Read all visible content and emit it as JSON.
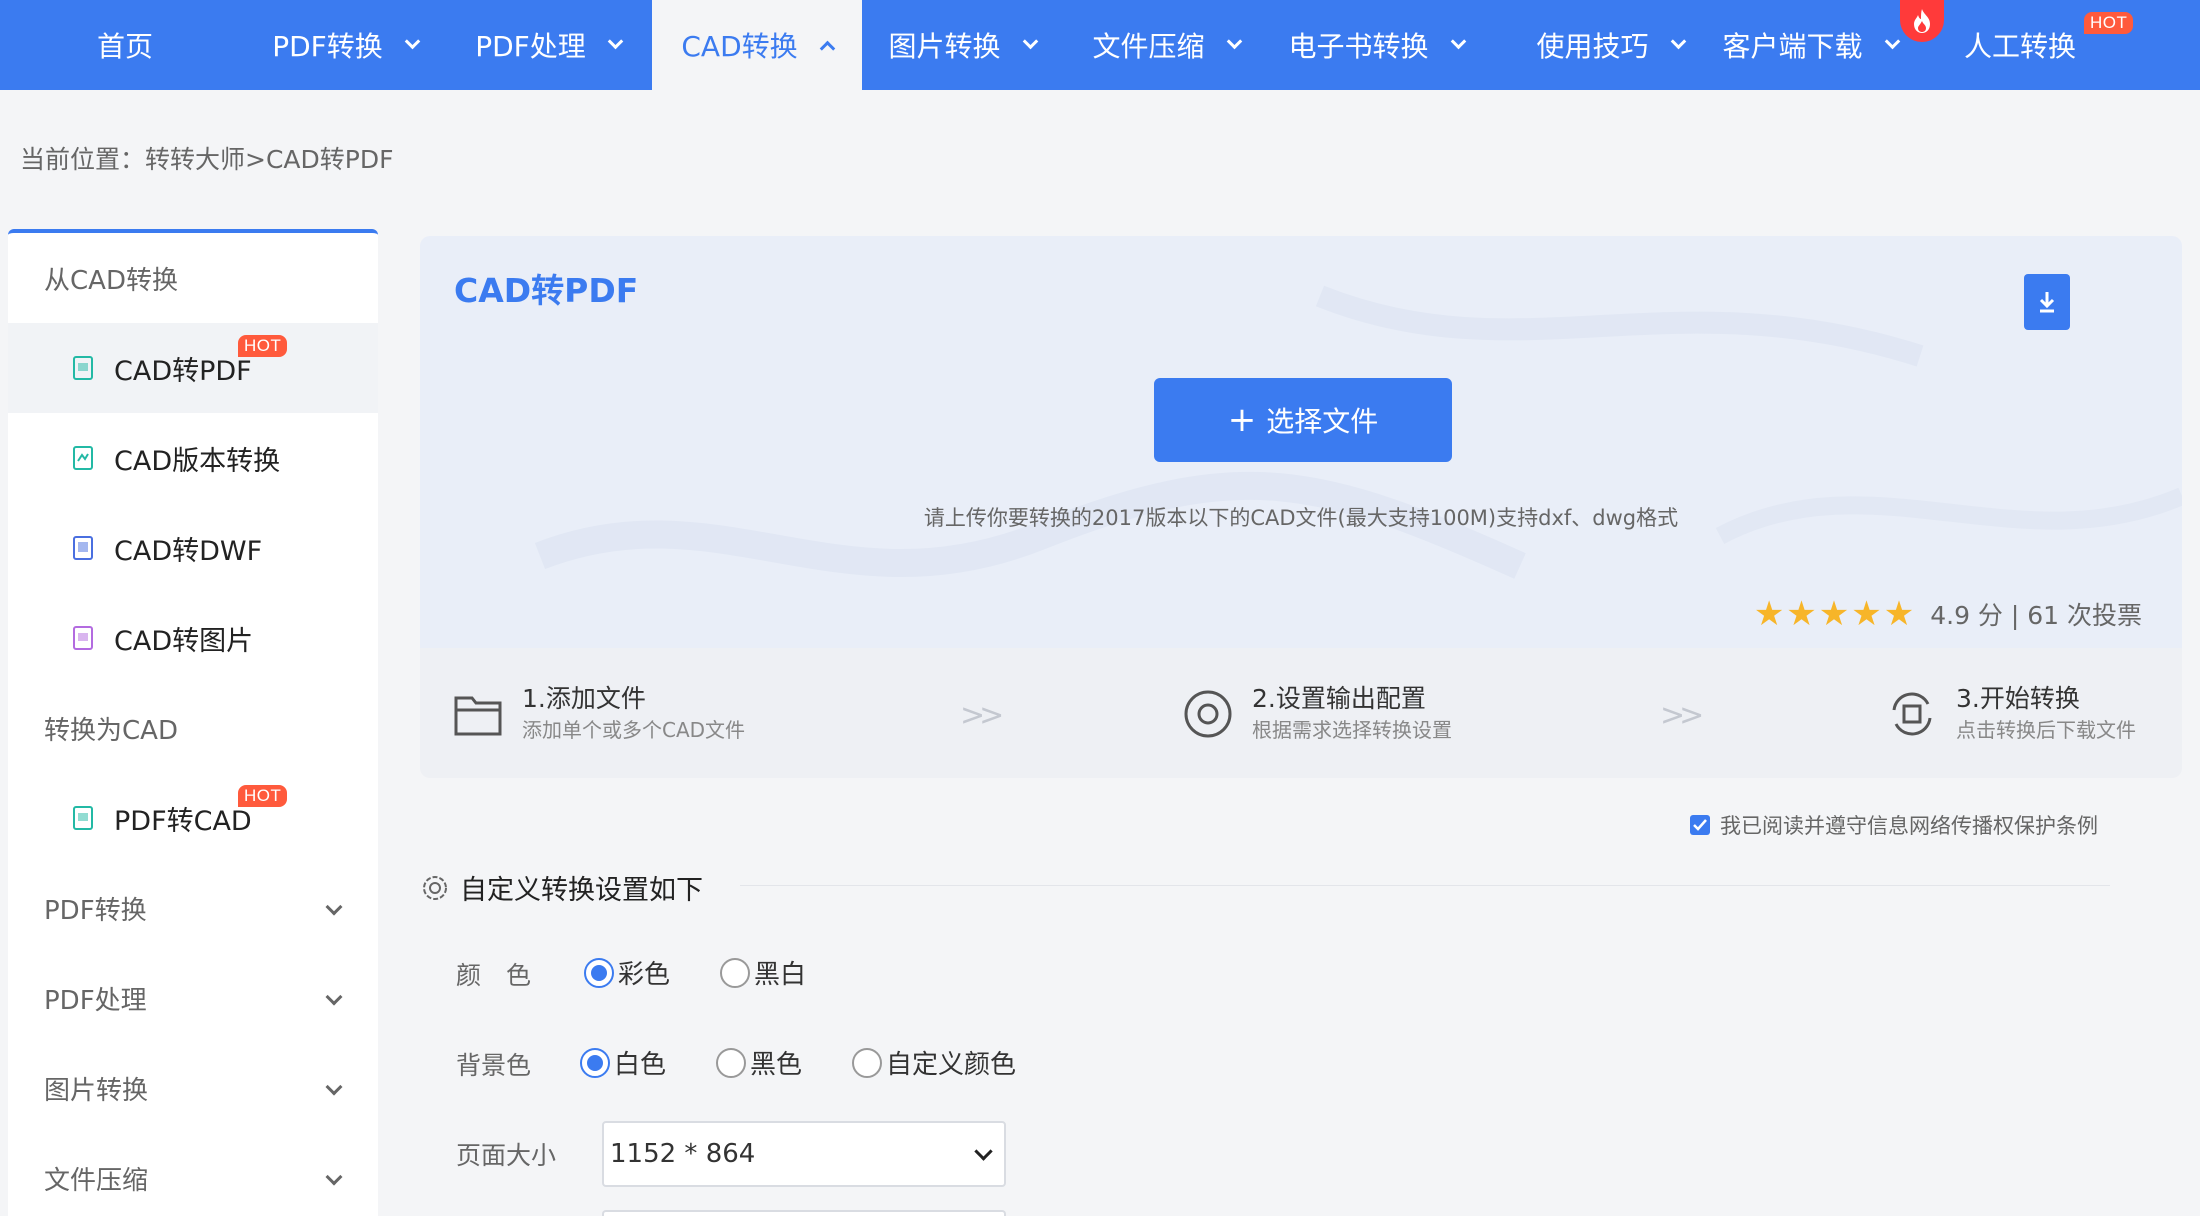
{
  "nav": {
    "items": [
      {
        "label": "首页"
      },
      {
        "label": "PDF转换"
      },
      {
        "label": "PDF处理"
      },
      {
        "label": "CAD转换"
      },
      {
        "label": "图片转换"
      },
      {
        "label": "文件压缩"
      },
      {
        "label": "电子书转换"
      },
      {
        "label": "使用技巧"
      },
      {
        "label": "客户端下载"
      },
      {
        "label": "人工转换"
      }
    ],
    "hot_label": "HOT",
    "active_color": "#3b7bf0"
  },
  "breadcrumb": "当前位置：转转大师>CAD转PDF",
  "sidebar": {
    "group_from": "从CAD转换",
    "items_from": [
      {
        "label": "CAD转PDF",
        "hot": "HOT"
      },
      {
        "label": "CAD版本转换"
      },
      {
        "label": "CAD转DWF"
      },
      {
        "label": "CAD转图片"
      }
    ],
    "group_to": "转换为CAD",
    "items_to": [
      {
        "label": "PDF转CAD",
        "hot": "HOT"
      }
    ],
    "collapsed": [
      {
        "label": "PDF转换"
      },
      {
        "label": "PDF处理"
      },
      {
        "label": "图片转换"
      },
      {
        "label": "文件压缩"
      }
    ]
  },
  "upload": {
    "title": "CAD转PDF",
    "button": "选择文件",
    "hint": "请上传你要转换的2017版本以下的CAD文件(最大支持100M)支持dxf、dwg格式",
    "stars": "★★★★★",
    "rating_text": "4.9 分 | 61 次投票"
  },
  "steps": [
    {
      "title": "1.添加文件",
      "sub": "添加单个或多个CAD文件"
    },
    {
      "title": "2.设置输出配置",
      "sub": "根据需求选择转换设置"
    },
    {
      "title": "3.开始转换",
      "sub": "点击转换后下载文件"
    }
  ],
  "agreement": "我已阅读并遵守信息网络传播权保护条例",
  "settings": {
    "header": "自定义转换设置如下",
    "color_label": "颜　色",
    "color_options": [
      "彩色",
      "黑白"
    ],
    "bg_label": "背景色",
    "bg_options": [
      "白色",
      "黑色",
      "自定义颜色"
    ],
    "page_label": "页面大小",
    "page_value": "1152 * 864"
  }
}
